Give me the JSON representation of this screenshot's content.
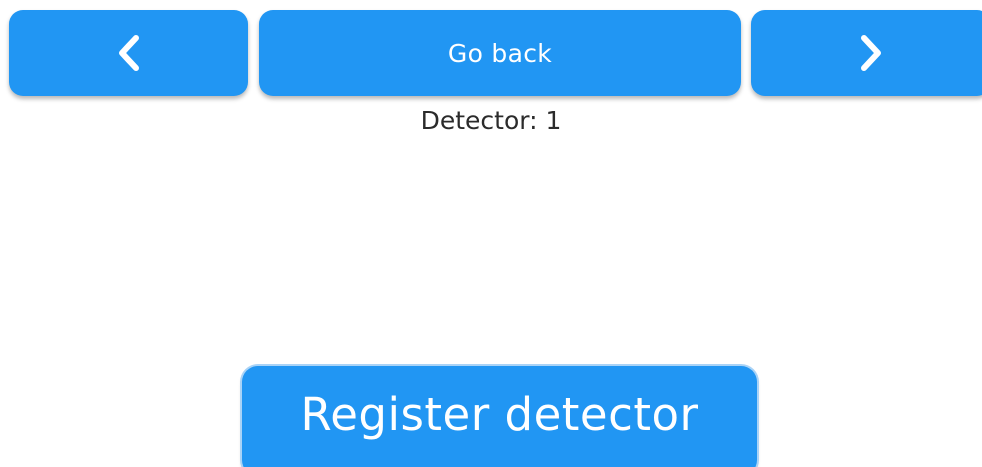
{
  "nav": {
    "prev_icon": "chevron-left-icon",
    "back_label": "Go back",
    "next_icon": "chevron-right-icon"
  },
  "detector": {
    "label": "Detector: 1"
  },
  "actions": {
    "register_label": "Register detector"
  },
  "colors": {
    "button": "#2196F3",
    "button_text": "#FFFFFF",
    "text": "#2B2B2B",
    "background": "#FFFFFF"
  }
}
